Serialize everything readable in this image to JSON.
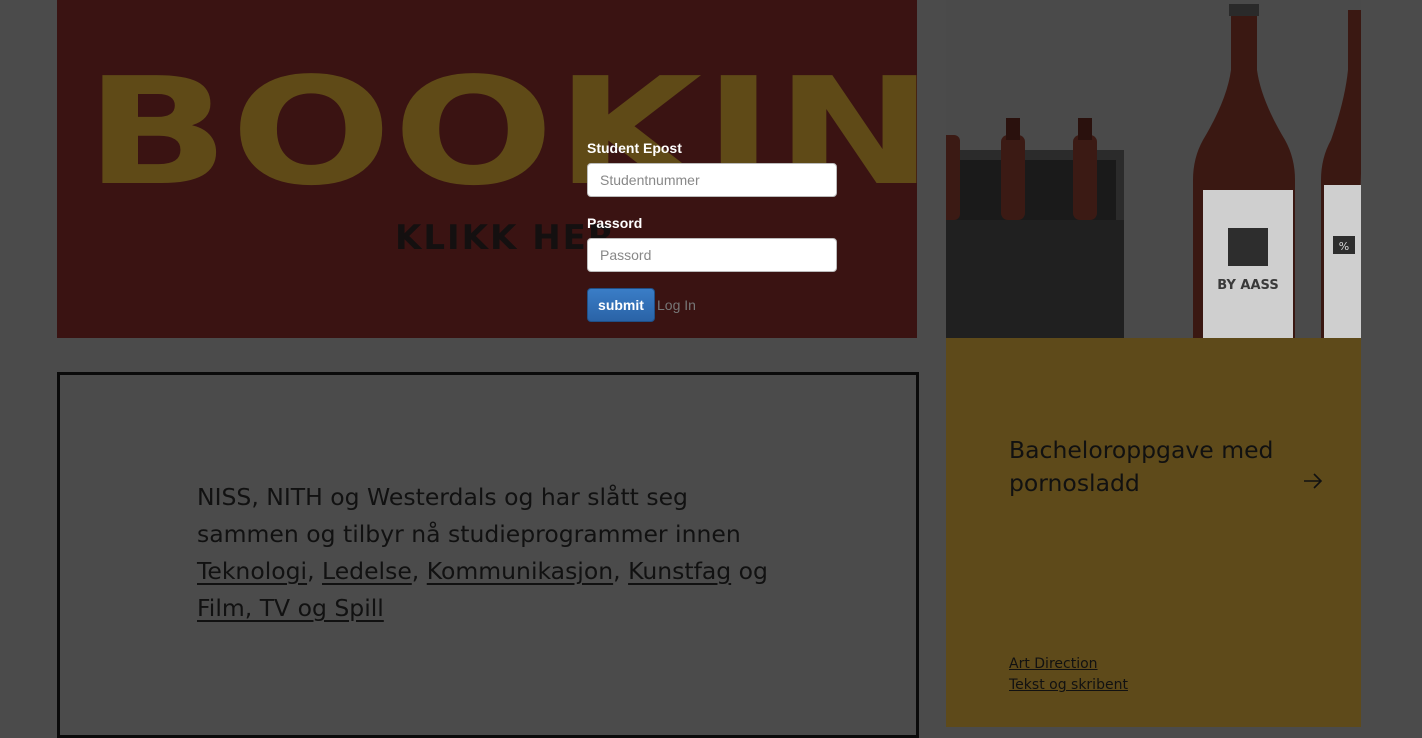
{
  "booking": {
    "title": "BOOKING",
    "subtitle": "KLIKK HER"
  },
  "bottles": {
    "label": "BY AASS",
    "badge": "%"
  },
  "news": {
    "intro": "NISS, NITH og Westerdals og har slått seg sammen og tilbyr nå studieprogrammer innen",
    "links": [
      "Teknologi",
      "Ledelse",
      "Kommunikasjon",
      "Kunstfag"
    ],
    "sep": ",",
    "conj": "og",
    "last_link": "Film, TV og Spill"
  },
  "case": {
    "title": "Bacheloroppgave med pornosladd",
    "tags": [
      "Art Direction",
      "Tekst og skribent"
    ],
    "arrow_icon": "arrow-right-icon"
  },
  "login": {
    "email_label": "Student Epost",
    "email_placeholder": "Studentnummer",
    "password_label": "Passord",
    "password_placeholder": "Passord",
    "submit_label": "submit",
    "login_link": "Log In"
  },
  "colors": {
    "overlay_bg": "#4b4b4b",
    "booking_bg": "#3a1312",
    "case_bg": "#5e4a1a",
    "accent": "#2a63a7"
  }
}
